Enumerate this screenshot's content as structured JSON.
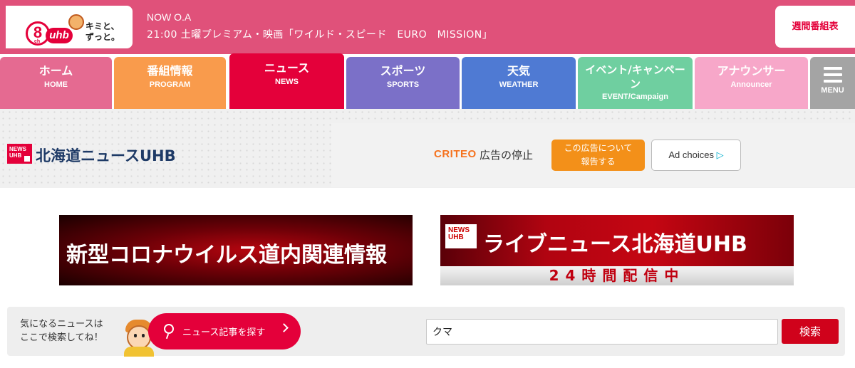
{
  "header": {
    "logo": {
      "channel": "8",
      "channel_sub": "ch",
      "brand": "uhb",
      "tagline_1": "キミと、",
      "tagline_2": "ずっと。"
    },
    "now_onair_label": "NOW O.A",
    "now_onair_program": "21:00 土曜プレミアム・映画「ワイルド・スピード　EURO　MISSION」",
    "schedule_label": "週間番組表",
    "bg_color": "#e0517a"
  },
  "nav": {
    "tabs": [
      {
        "jp": "ホーム",
        "en": "HOME",
        "color": "#e56a91"
      },
      {
        "jp": "番組情報",
        "en": "PROGRAM",
        "color": "#f99b4c"
      },
      {
        "jp": "ニュース",
        "en": "NEWS",
        "color": "#e4003a"
      },
      {
        "jp": "スポーツ",
        "en": "SPORTS",
        "color": "#7b70c8"
      },
      {
        "jp": "天気",
        "en": "WEATHER",
        "color": "#4f7ad3"
      },
      {
        "jp": "イベント/キャンペーン",
        "en": "EVENT/Campaign",
        "color": "#6fcfa0"
      },
      {
        "jp": "アナウンサー",
        "en": "Announcer",
        "color": "#f7a7c9"
      }
    ],
    "active_index": 2,
    "menu_label": "MENU"
  },
  "site": {
    "badge_line1": "NEWS",
    "badge_line2": "UHB",
    "name": "北海道ニュースUHB"
  },
  "ad": {
    "criteo": "CRITEO",
    "stop_label": "広告の停止",
    "report_line1": "この広告について",
    "report_line2": "報告する",
    "adchoices_label": "Ad choices",
    "adchoices_icon": "adchoices-triangle"
  },
  "banners": {
    "corona": "新型コロナウイルス道内関連情報",
    "live_badge_line1": "NEWS",
    "live_badge_line2": "UHB",
    "live_headline": "ライブニュース北海道UHB",
    "live_sub": "24時間配信中"
  },
  "search": {
    "hint_line1": "気になるニュースは",
    "hint_line2": "ここで検索してね！",
    "find_button": "ニュース記事を探す",
    "input_value": "クマ",
    "submit_label": "検索"
  }
}
